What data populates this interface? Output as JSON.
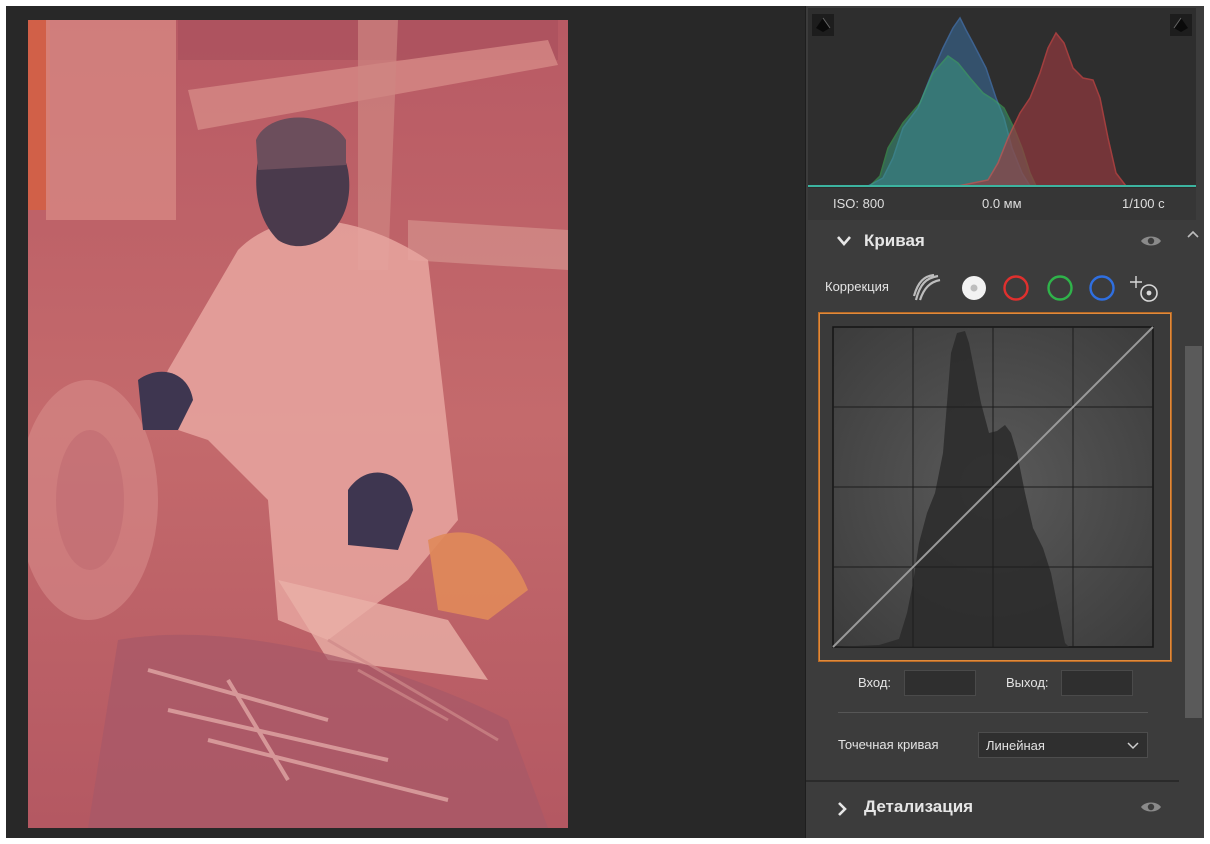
{
  "histogram": {
    "iso": "ISO: 800",
    "focal": "0.0 мм",
    "shutter": "1/100 с",
    "shadow_clip_icon": "shadow-clipping-warning-icon",
    "highlight_clip_icon": "highlight-clipping-warning-icon"
  },
  "curve_panel": {
    "title": "Кривая",
    "correction_label": "Коррекция",
    "channels": [
      {
        "name": "parametric-curve-icon"
      },
      {
        "name": "rgb-point-curve",
        "color": "#ffffff"
      },
      {
        "name": "red-channel",
        "color": "#e0302e"
      },
      {
        "name": "green-channel",
        "color": "#2fb34a"
      },
      {
        "name": "blue-channel",
        "color": "#2f6fe0"
      },
      {
        "name": "targeted-adjustment-icon"
      }
    ],
    "input_label": "Вход:",
    "input_value": "",
    "output_label": "Выход:",
    "output_value": "",
    "point_curve_label": "Точечная кривая",
    "point_curve_value": "Линейная",
    "highlight_color": "#e08a3c"
  },
  "detail_panel": {
    "title": "Детализация"
  }
}
